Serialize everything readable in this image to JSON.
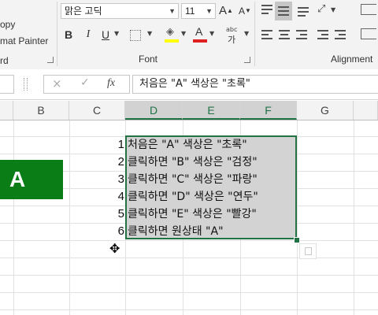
{
  "ribbon": {
    "clipboard_partial": "opy",
    "format_painter_partial": "mat Painter",
    "clipboard_group_partial": "rd",
    "font_name": "맑은 고딕",
    "font_size": "11",
    "bold": "B",
    "italic": "I",
    "underline": "U",
    "phonetic": "가",
    "font_group_label": "Font",
    "alignment_group_label": "Alignment",
    "accent_color": "#217346",
    "font_color_bar": "#e02020",
    "fill_color_bar": "#ffff00"
  },
  "formula_bar": {
    "cancel_icon": "×",
    "enter_icon": "✓",
    "fx_label": "fx",
    "content": "처음은 \"A\"    색상은 \"초록\""
  },
  "columns": [
    "B",
    "C",
    "D",
    "E",
    "F",
    "G"
  ],
  "selected_columns": [
    "D",
    "E",
    "F"
  ],
  "shape": {
    "label": "A",
    "color": "#0a7d16"
  },
  "rows": [
    {
      "num": "1",
      "text": "처음은 \"A\"    색상은  \"초록\""
    },
    {
      "num": "2",
      "text": "클릭하면 \"B\"  색상은 \"검정\""
    },
    {
      "num": "3",
      "text": "클릭하면 \"C\"  색상은  \"파랑\""
    },
    {
      "num": "4",
      "text": "클릭하면 \"D\"  색상은  \"연두\""
    },
    {
      "num": "5",
      "text": "클릭하면 \"E\"   색상은  \"빨강\""
    },
    {
      "num": "6",
      "text": "클릭하면  원상태  \"A\""
    }
  ]
}
